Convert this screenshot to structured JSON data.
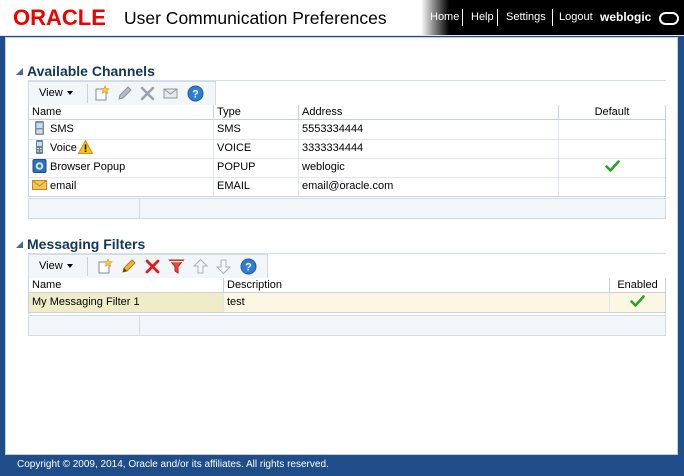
{
  "header": {
    "logo": "ORACLE",
    "title": "User Communication Preferences",
    "nav": [
      "Home",
      "Help",
      "Settings",
      "Logout"
    ],
    "user": "weblogic"
  },
  "channels": {
    "title": "Available Channels",
    "view_label": "View",
    "columns": [
      "Name",
      "Type",
      "Address",
      "Default"
    ],
    "rows": [
      {
        "name": "SMS",
        "type": "SMS",
        "address": "5553334444",
        "icon": "sms-icon",
        "default": false
      },
      {
        "name": "Voice",
        "type": "VOICE",
        "address": "3333334444",
        "icon": "voice-icon",
        "default": false
      },
      {
        "name": "Browser Popup",
        "type": "POPUP",
        "address": "weblogic",
        "icon": "browser-popup-icon",
        "default": true
      },
      {
        "name": "email",
        "type": "EMAIL",
        "address": "email@oracle.com",
        "icon": "email-icon",
        "default": false
      }
    ]
  },
  "filters": {
    "title": "Messaging Filters",
    "view_label": "View",
    "columns": [
      "Name",
      "Description",
      "Enabled"
    ],
    "rows": [
      {
        "name": "My Messaging Filter 1",
        "description": "test",
        "enabled": true
      }
    ]
  },
  "footer": {
    "copyright": "Copyright © 2009, 2014, Oracle and/or its affiliates. All rights reserved."
  },
  "colors": {
    "brand_red": "#f00000",
    "frame_blue": "#1f4d8a",
    "section_title": "#11375b",
    "selected_row": "#fbf7e3",
    "check_green": "#2ba12b"
  }
}
